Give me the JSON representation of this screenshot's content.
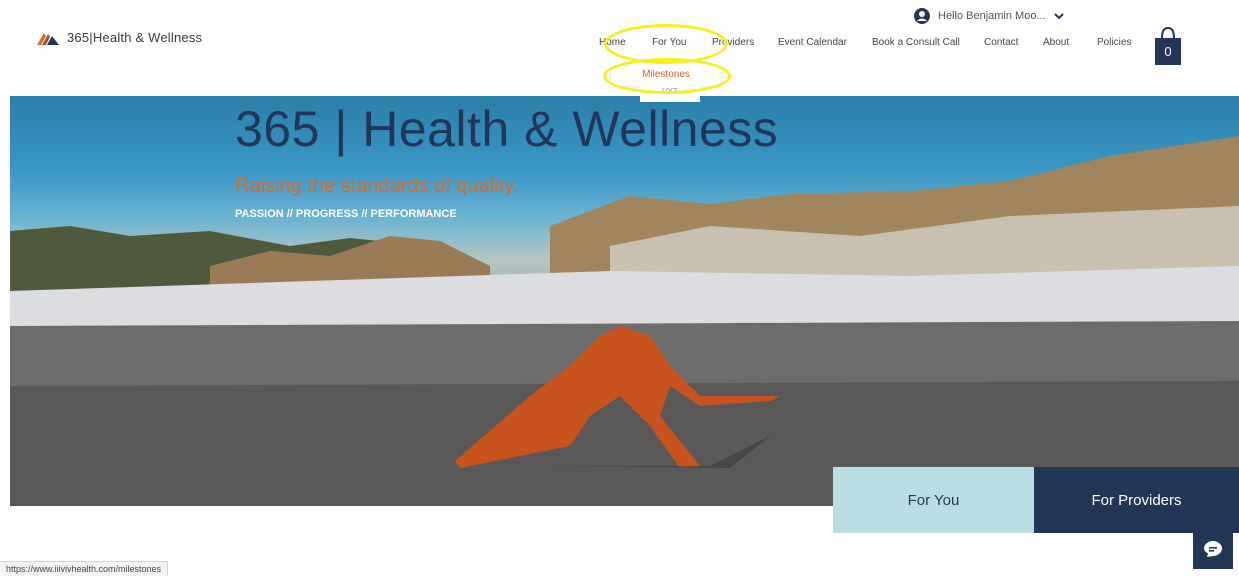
{
  "header": {
    "logo_text": "365|Health & Wellness",
    "user_greeting": "Hello Benjamin Moo...",
    "cart_count": "0",
    "nav": [
      "Home",
      "For You",
      "Providers",
      "Event Calendar",
      "Book a Consult Call",
      "Contact",
      "About",
      "Policies"
    ],
    "dropdown_item": "Milestones",
    "dropdown_stub": "VYT"
  },
  "hero": {
    "title": "365 | Health & Wellness",
    "subtitle": "Raising the standards of quality.",
    "tagline": "PASSION // PROGRESS // PERFORMANCE"
  },
  "cta": {
    "for_you": "For You",
    "for_providers": "For Providers"
  },
  "status_url": "https://www.iiivivhealth.com/milestones",
  "colors": {
    "navy": "#233657",
    "orange": "#d86a2a",
    "light_teal": "#b8dde3",
    "highlight": "#f4f01a"
  },
  "icons": {
    "logo": "mountain-stripes-icon",
    "user": "user-avatar-icon",
    "cart": "shopping-bag-icon",
    "chat": "chat-bubble-icon"
  }
}
